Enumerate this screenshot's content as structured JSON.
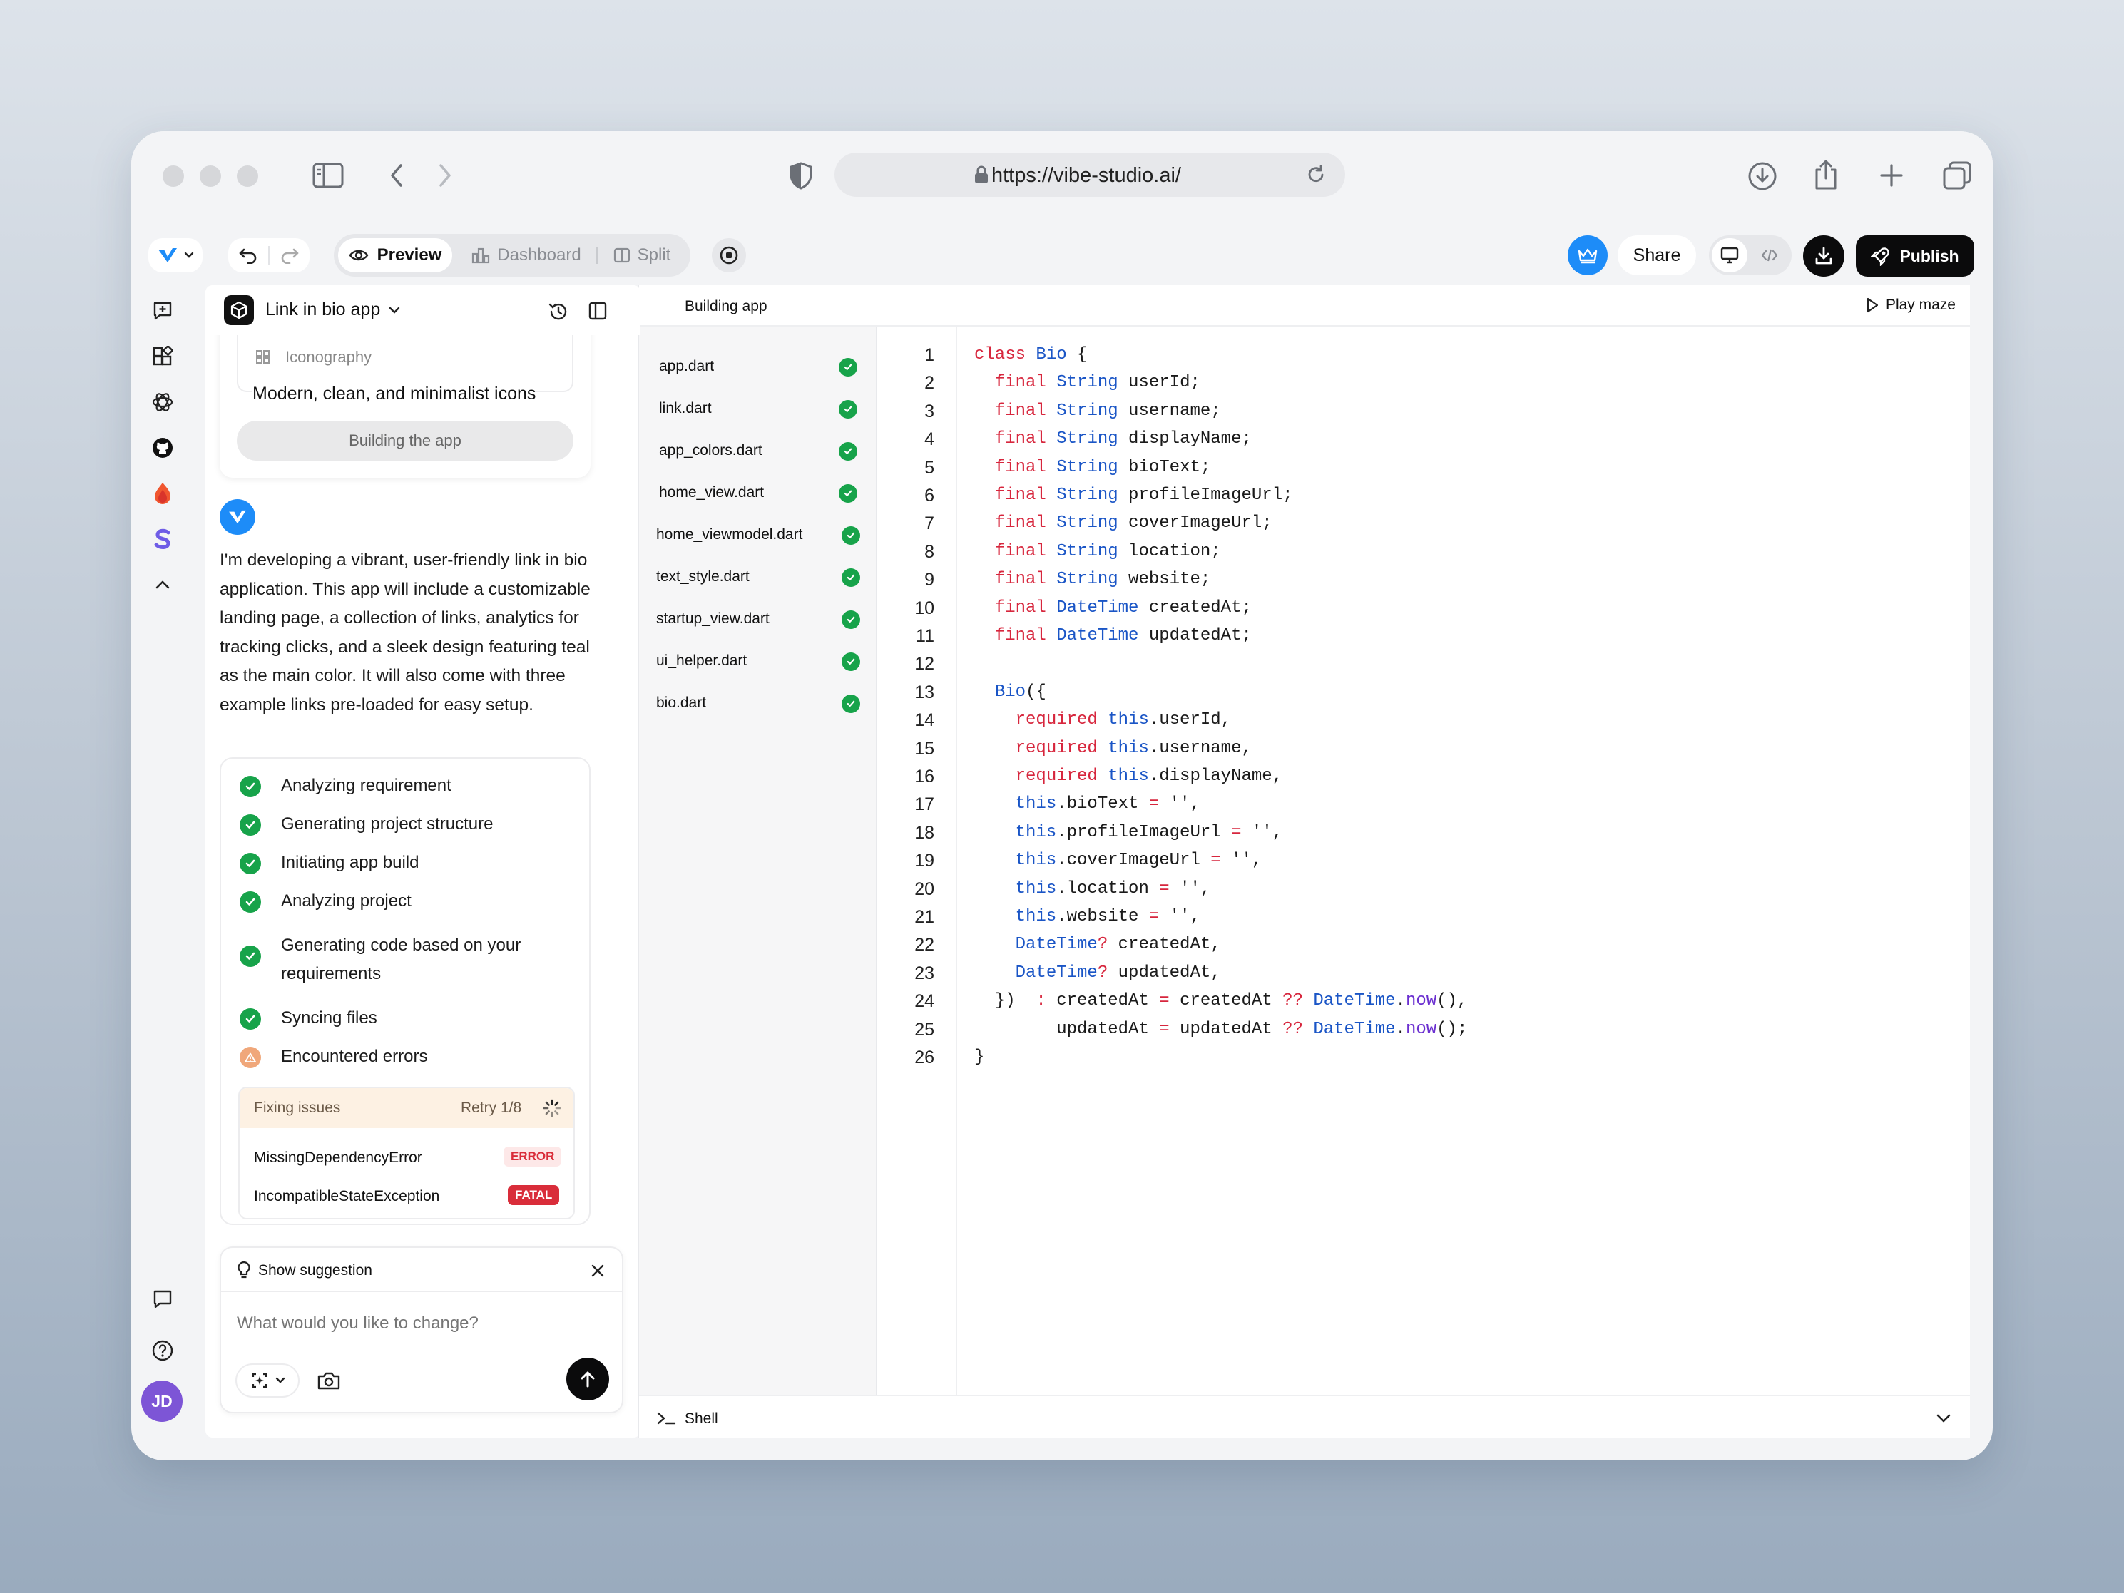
{
  "browser": {
    "url": "https://vibe-studio.ai/"
  },
  "toolbar": {
    "tabs": [
      {
        "label": "Preview",
        "icon": "eye-icon",
        "active": true
      },
      {
        "label": "Dashboard",
        "icon": "chart-icon",
        "active": false
      },
      {
        "label": "Split",
        "icon": "split-icon",
        "active": false
      }
    ],
    "share_label": "Share",
    "publish_label": "Publish"
  },
  "chat": {
    "project_name": "Link in bio app",
    "card": {
      "section_label": "Iconography",
      "section_value": "Modern, clean, and minimalist icons",
      "status_button": "Building the app"
    },
    "message": "I'm developing a vibrant, user-friendly link in bio application. This app will include a customizable landing page, a collection of links, analytics for tracking clicks, and a sleek design featuring teal as the main color. It will also come with three example links pre-loaded for easy setup.",
    "steps": [
      {
        "label": "Analyzing requirement",
        "status": "done"
      },
      {
        "label": "Generating project structure",
        "status": "done"
      },
      {
        "label": "Initiating app build",
        "status": "done"
      },
      {
        "label": "Analyzing project",
        "status": "done"
      },
      {
        "label": "Generating code based on your requirements",
        "status": "done"
      },
      {
        "label": "Syncing files",
        "status": "done"
      },
      {
        "label": "Encountered errors",
        "status": "warning"
      }
    ],
    "fixing": {
      "label": "Fixing issues",
      "retry": "Retry 1/8",
      "errors": [
        {
          "name": "MissingDependencyError",
          "level": "ERROR"
        },
        {
          "name": "IncompatibleStateException",
          "level": "FATAL"
        }
      ]
    },
    "suggestion_label": "Show suggestion",
    "input_placeholder": "What would you like to change?"
  },
  "user": {
    "initials": "JD"
  },
  "workspace": {
    "status": "Building app",
    "play_label": "Play maze",
    "shell_label": "Shell",
    "files": [
      "app.dart",
      "link.dart",
      "app_colors.dart",
      "home_view.dart",
      "home_viewmodel.dart",
      "text_style.dart",
      "startup_view.dart",
      "ui_helper.dart",
      "bio.dart"
    ],
    "code_lines": [
      "class Bio {",
      "  final String userId;",
      "  final String username;",
      "  final String displayName;",
      "  final String bioText;",
      "  final String profileImageUrl;",
      "  final String coverImageUrl;",
      "  final String location;",
      "  final String website;",
      "  final DateTime createdAt;",
      "  final DateTime updatedAt;",
      "",
      "  Bio({",
      "    required this.userId,",
      "    required this.username,",
      "    required this.displayName,",
      "    this.bioText = '',",
      "    this.profileImageUrl = '',",
      "    this.coverImageUrl = '',",
      "    this.location = '',",
      "    this.website = '',",
      "    DateTime? createdAt,",
      "    DateTime? updatedAt,",
      "  })  : createdAt = createdAt ?? DateTime.now(),",
      "        updatedAt = updatedAt ?? DateTime.now();",
      "}"
    ]
  },
  "colors": {
    "accent": "#1d8cf8",
    "success": "#17a34a",
    "error": "#d92d3a",
    "warning": "#f0a77a"
  }
}
